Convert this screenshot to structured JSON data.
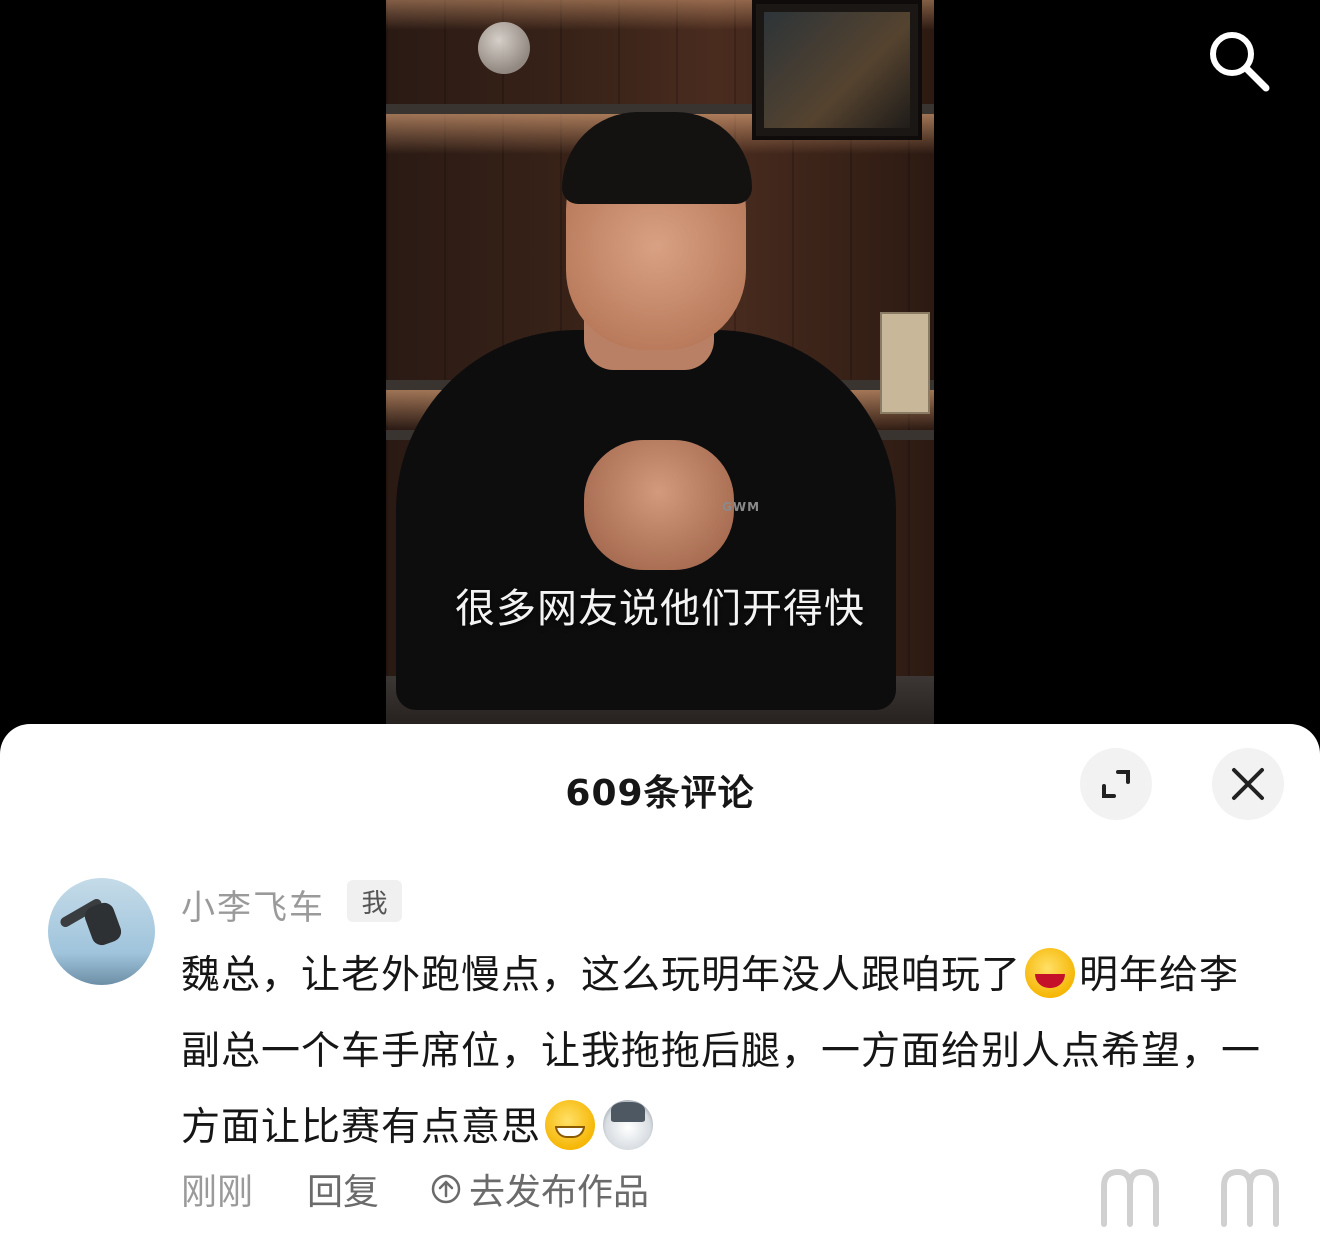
{
  "video": {
    "subtitle": "很多网友说他们开得快",
    "shirt_logo": "GWM"
  },
  "top_bar": {
    "search_icon": "search-icon"
  },
  "comments_panel": {
    "title": "609条评论",
    "expand_icon": "expand-icon",
    "close_icon": "close-icon"
  },
  "comment": {
    "username": "小李飞车",
    "badge": "我",
    "text_1": "魏总，让老外跑慢点，这么玩明年没人跟咱玩了",
    "text_2": "明年给李副总一个车手席位，让我拖拖后腿，一方面给别人点希望，一方面让比赛有点意思",
    "emoji_1": "laughing-crying-emoji",
    "emoji_2": "grinning-emoji",
    "emoji_3": "husky-dog-emoji",
    "time": "刚刚",
    "reply_label": "回复",
    "publish_label": "去发布作品"
  },
  "colors": {
    "sheet_background": "#ffffff",
    "muted_text": "#9a9a9a",
    "primary_text": "#161616",
    "button_background": "#f2f2f2"
  }
}
